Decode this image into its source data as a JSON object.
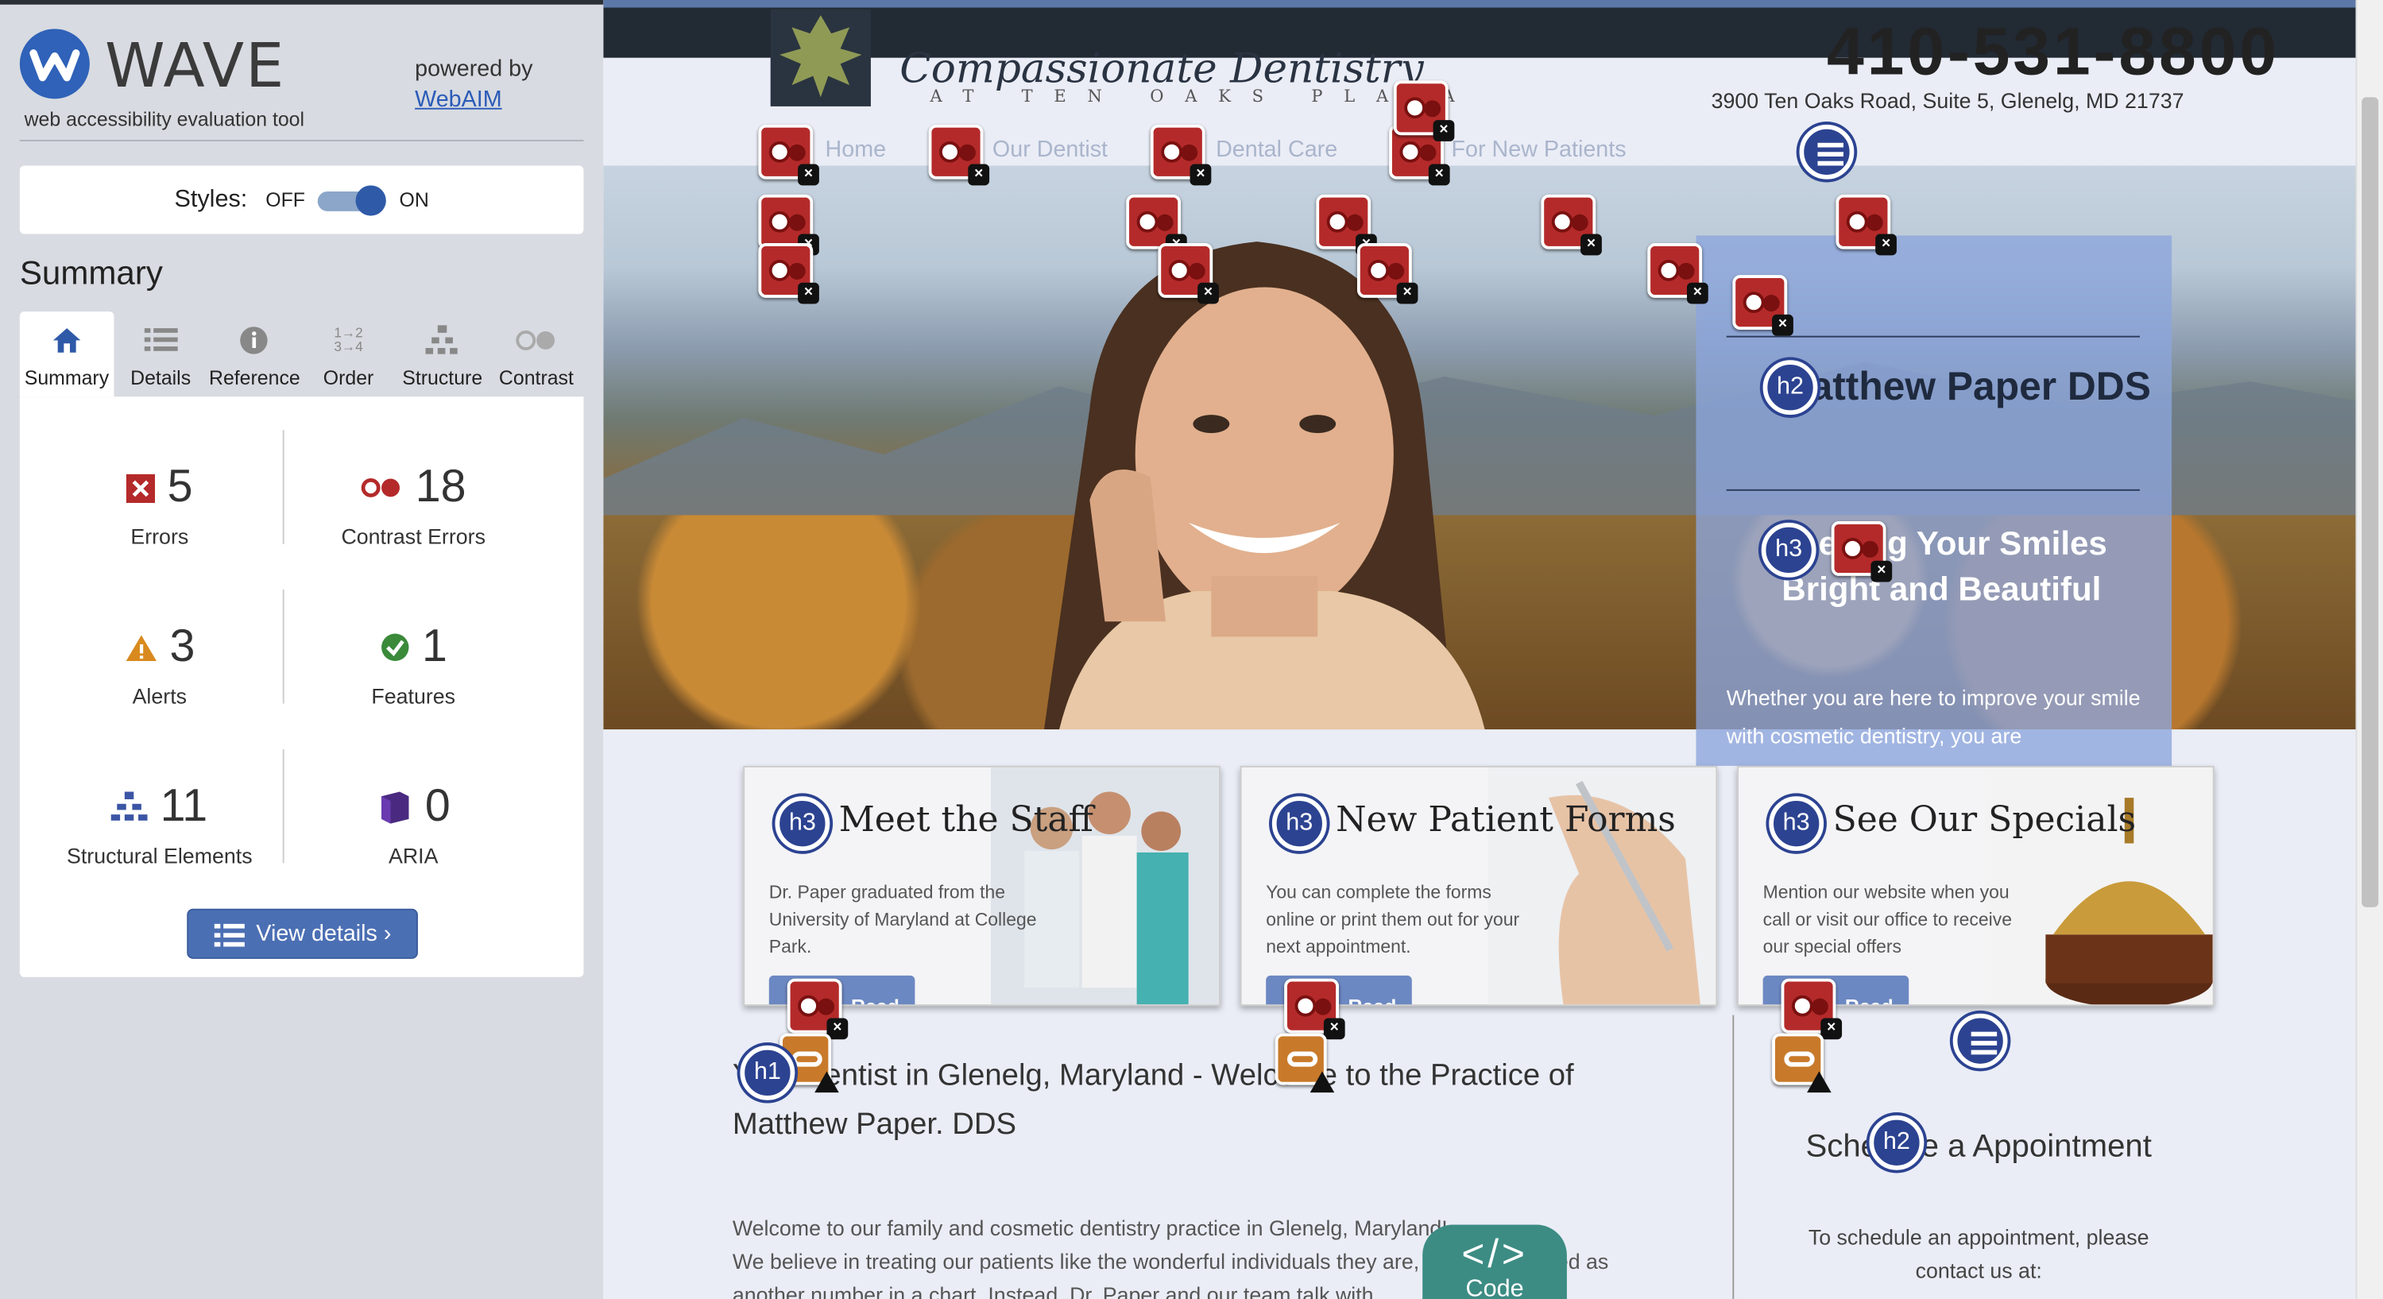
{
  "wave": {
    "name": "WAVE",
    "tagline": "web accessibility evaluation tool",
    "powered_by": "powered by",
    "webaim": "WebAIM",
    "styles_label": "Styles:",
    "toggle_off": "OFF",
    "toggle_on": "ON",
    "summary_title": "Summary",
    "tabs": [
      {
        "label": "Summary",
        "icon": "home-icon"
      },
      {
        "label": "Details",
        "icon": "list-icon"
      },
      {
        "label": "Reference",
        "icon": "info-icon"
      },
      {
        "label": "Order",
        "icon": "order-icon"
      },
      {
        "label": "Structure",
        "icon": "structure-icon"
      },
      {
        "label": "Contrast",
        "icon": "contrast-icon"
      }
    ],
    "stats": {
      "errors": {
        "count": "5",
        "label": "Errors"
      },
      "contrast": {
        "count": "18",
        "label": "Contrast Errors"
      },
      "alerts": {
        "count": "3",
        "label": "Alerts"
      },
      "features": {
        "count": "1",
        "label": "Features"
      },
      "structural": {
        "count": "11",
        "label": "Structural Elements"
      },
      "aria": {
        "count": "0",
        "label": "ARIA"
      }
    },
    "view_details": "View details ›",
    "colors": {
      "accent": "#2f5aa8",
      "error": "#b42a2a",
      "alert": "#d98a1e",
      "feature": "#3a8a3a"
    }
  },
  "site": {
    "logo_main": "Compassionate Dentistry",
    "logo_sub": "AT TEN OAKS PLAZA",
    "phone": "410-531-8800",
    "address": "3900 Ten Oaks Road, Suite 5, Glenelg, MD 21737",
    "nav": [
      "Home",
      "Our Dentist",
      "Dental Care",
      "For New Patients"
    ],
    "sidebox": {
      "h2": "Matthew Paper DDS",
      "h3": "Keeping Your Smiles Bright and Beautiful",
      "p": "Whether you are here to improve your smile with cosmetic dentistry, you are"
    },
    "cards": [
      {
        "title": "Meet the Staff",
        "text": "Dr. Paper graduated from the University of Maryland at College Park.",
        "button": "Read"
      },
      {
        "title": "New Patient Forms",
        "text": "You can complete the forms online or print them out for your next appointment.",
        "button": "Read"
      },
      {
        "title": "See Our Specials",
        "text": "Mention our website when you call or visit our office to receive our special offers",
        "button": "Read"
      }
    ],
    "h1": "Your Dentist in Glenelg, Maryland - Welcome to the Practice of",
    "h1_line2": "Matthew Paper. DDS",
    "body1": "Welcome to our family and cosmetic dentistry practice in Glenelg, Maryland!",
    "body2": "We believe in treating our patients like the wonderful individuals they are, never be viewed as another number in a chart. Instead, Dr. Paper and our team talk with",
    "schedule_h2": "Schedule a Appointment",
    "schedule_p": "To schedule an appointment, please contact us at:",
    "code_tag": "</>",
    "code_label": "Code"
  }
}
